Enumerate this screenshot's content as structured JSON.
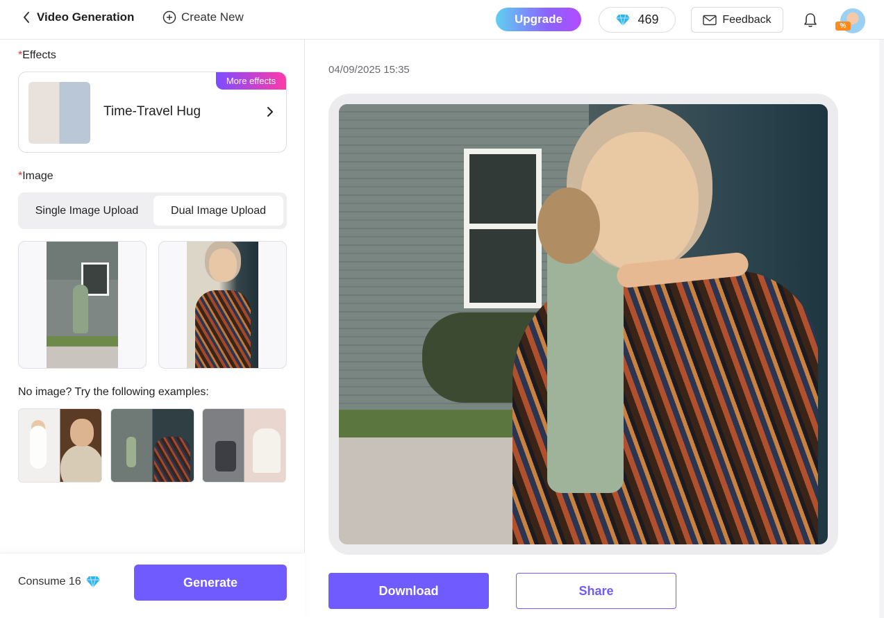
{
  "header": {
    "title": "Video Generation",
    "create_new_label": "Create New",
    "upgrade_label": "Upgrade",
    "credits": "469",
    "feedback_label": "Feedback",
    "avatar_badge": "%"
  },
  "left": {
    "effects_label": "Effects",
    "effect": {
      "name": "Time-Travel Hug",
      "more_effects_label": "More effects"
    },
    "image_label": "Image",
    "upload_modes": [
      "Single Image Upload",
      "Dual Image Upload"
    ],
    "selected_upload_mode": "Dual Image Upload",
    "examples_label": "No image? Try the following examples:",
    "consume_label": "Consume 16",
    "generate_label": "Generate"
  },
  "right": {
    "timestamp": "04/09/2025 15:35",
    "download_label": "Download",
    "share_label": "Share"
  },
  "icons": {
    "back": "chevron-left-icon",
    "create_new": "plus-circle-icon",
    "credits": "diamond-icon",
    "feedback": "mail-icon",
    "notifications": "bell-icon",
    "effect_nav": "chevron-right-icon"
  },
  "colors": {
    "accent": "#6f5bff",
    "diamond": "#2fb4f2",
    "required": "#e53935"
  }
}
